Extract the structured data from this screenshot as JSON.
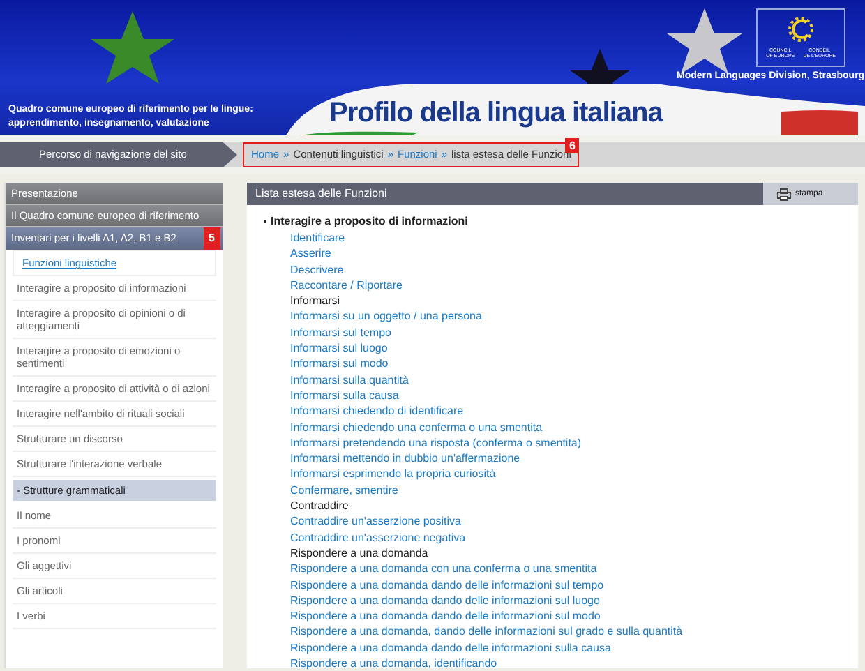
{
  "banner": {
    "subtitle_lines": [
      "Quadro comune europeo di riferimento per le lingue:",
      "apprendimento, insegnamento, valutazione"
    ],
    "title": "Profilo della lingua italiana",
    "logo": {
      "left_caption": [
        "COUNCIL",
        "OF EUROPE"
      ],
      "right_caption": [
        "CONSEIL",
        "DE L'EUROPE"
      ]
    },
    "division": "Modern Languages Division, Strasbourg"
  },
  "breadcrumb": {
    "label": "Percorso di navigazione del sito",
    "badge": "6",
    "items": [
      {
        "label": "Home",
        "kind": "link"
      },
      {
        "label": "»",
        "kind": "separator"
      },
      {
        "label": "Contenuti linguistici",
        "kind": "text"
      },
      {
        "label": "»",
        "kind": "separator"
      },
      {
        "label": "Funzioni",
        "kind": "link"
      },
      {
        "label": "»",
        "kind": "separator"
      },
      {
        "label": "lista estesa delle Funzioni",
        "kind": "text"
      }
    ]
  },
  "sidebar": {
    "items": [
      {
        "label": "Presentazione",
        "kind": "section"
      },
      {
        "label": "Il Quadro comune europeo di riferimento",
        "kind": "section"
      },
      {
        "label": "Inventari per i livelli A1, A2, B1 e B2",
        "kind": "section-active",
        "badge": "5"
      },
      {
        "label": "Funzioni linguistiche",
        "kind": "link",
        "selected": true
      },
      {
        "label": "Interagire a proposito di informazioni",
        "kind": "link",
        "selected": false
      },
      {
        "label": "Interagire a proposito di opinioni o di atteggiamenti",
        "kind": "link",
        "selected": false
      },
      {
        "label": "Interagire a proposito di emozioni o sentimenti",
        "kind": "link",
        "selected": false
      },
      {
        "label": "Interagire a proposito di attività o di azioni",
        "kind": "link",
        "selected": false
      },
      {
        "label": "Interagire nell'ambito di rituali sociali",
        "kind": "link",
        "selected": false
      },
      {
        "label": "Strutturare un discorso",
        "kind": "link",
        "selected": false
      },
      {
        "label": "Strutturare l'interazione verbale",
        "kind": "link",
        "selected": false
      },
      {
        "label": "- Strutture grammaticali",
        "kind": "subsection"
      },
      {
        "label": "Il nome",
        "kind": "link",
        "selected": false
      },
      {
        "label": "I pronomi",
        "kind": "link",
        "selected": false
      },
      {
        "label": "Gli aggettivi",
        "kind": "link",
        "selected": false
      },
      {
        "label": "Gli articoli",
        "kind": "link",
        "selected": false
      },
      {
        "label": "I verbi",
        "kind": "link",
        "selected": false
      }
    ]
  },
  "panel": {
    "title": "Lista estesa delle Funzioni",
    "print_button": "stampa",
    "group": "Interagire a proposito di informazioni",
    "items": [
      {
        "label": "Identificare",
        "kind": "link"
      },
      {
        "label": "Asserire",
        "kind": "link"
      },
      {
        "label": "Descrivere",
        "kind": "link"
      },
      {
        "label": "Raccontare / Riportare",
        "kind": "link"
      },
      {
        "label": "Informarsi",
        "kind": "heading"
      },
      {
        "label": "Informarsi su un oggetto / una persona",
        "kind": "link"
      },
      {
        "label": "Informarsi sul tempo",
        "kind": "link"
      },
      {
        "label": "Informarsi sul luogo",
        "kind": "link"
      },
      {
        "label": "Informarsi sul modo",
        "kind": "link"
      },
      {
        "label": "Informarsi sulla quantità",
        "kind": "link"
      },
      {
        "label": "Informarsi sulla causa",
        "kind": "link"
      },
      {
        "label": "Informarsi chiedendo di identificare",
        "kind": "link"
      },
      {
        "label": "Informarsi chiedendo una conferma o una smentita",
        "kind": "link"
      },
      {
        "label": "Informarsi pretendendo una risposta (conferma o smentita)",
        "kind": "link"
      },
      {
        "label": "Informarsi mettendo in dubbio un'affermazione",
        "kind": "link"
      },
      {
        "label": "Informarsi esprimendo la propria curiosità",
        "kind": "link"
      },
      {
        "label": "Confermare, smentire",
        "kind": "link"
      },
      {
        "label": "Contraddire",
        "kind": "heading"
      },
      {
        "label": "Contraddire un'asserzione positiva",
        "kind": "link"
      },
      {
        "label": "Contraddire un'asserzione negativa",
        "kind": "link"
      },
      {
        "label": "Rispondere a una domanda",
        "kind": "heading"
      },
      {
        "label": "Rispondere a una domanda con una conferma o una smentita",
        "kind": "link"
      },
      {
        "label": "Rispondere a una domanda dando delle informazioni sul tempo",
        "kind": "link"
      },
      {
        "label": "Rispondere a una domanda dando delle informazioni sul luogo",
        "kind": "link"
      },
      {
        "label": "Rispondere a una domanda dando delle informazioni sul modo",
        "kind": "link"
      },
      {
        "label": "Rispondere a una domanda, dando delle informazioni sul grado e sulla quantità",
        "kind": "link"
      },
      {
        "label": "Rispondere a una domanda dando delle informazioni sulla causa",
        "kind": "link"
      },
      {
        "label": "Rispondere a una domanda, identificando",
        "kind": "link"
      }
    ]
  }
}
